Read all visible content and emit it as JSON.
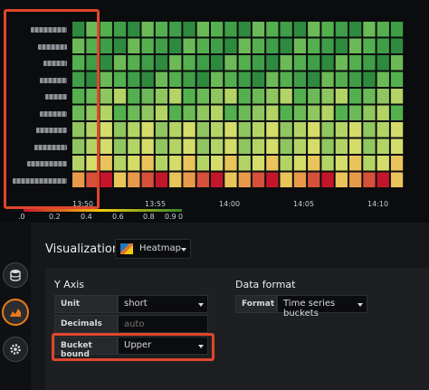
{
  "colors": {
    "heat": [
      "#2e8a3e",
      "#3f9e47",
      "#54b04f",
      "#6cba57",
      "#8fc65f",
      "#b3d465",
      "#d4dc6a",
      "#e8c45a",
      "#e89a4a",
      "#d6503a",
      "#c4162a"
    ],
    "annotation": "#e0462d",
    "active_tab": "#eb7b18"
  },
  "heatmap": {
    "x_ticks": [
      "13:50",
      "13:55",
      "14:00",
      "14:05",
      "14:10"
    ],
    "legend_ticks": [
      ".0",
      "0.2",
      "0.4",
      "0.6",
      "0.8",
      "0.9",
      "0"
    ],
    "row_count": 10
  },
  "sidebar": {
    "items": [
      {
        "icon": "database-icon"
      },
      {
        "icon": "chart-area-icon",
        "active": true
      },
      {
        "icon": "gear-icon"
      }
    ]
  },
  "visualization": {
    "title": "Visualization",
    "selected": "Heatmap",
    "thumb_icon": "heatmap-thumbnail-icon"
  },
  "y_axis": {
    "title": "Y Axis",
    "unit_label": "Unit",
    "unit_value": "short",
    "decimals_label": "Decimals",
    "decimals_placeholder": "auto",
    "bucket_bound_label": "Bucket bound",
    "bucket_bound_value": "Upper"
  },
  "data_format": {
    "title": "Data format",
    "format_label": "Format",
    "format_value": "Time series buckets"
  }
}
